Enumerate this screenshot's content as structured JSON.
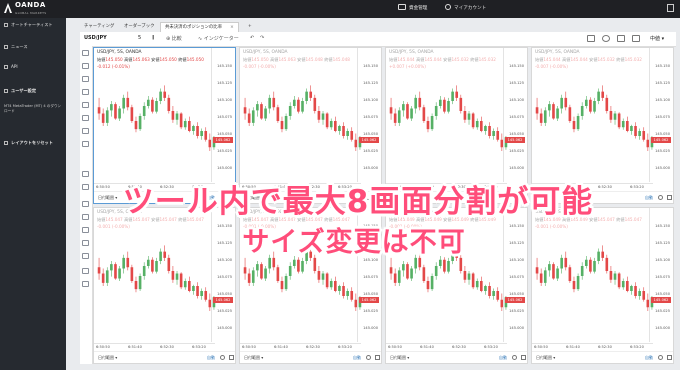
{
  "topbar": {
    "logo": "OANDA",
    "logo_sub": "GLOBAL MARKETS",
    "items": [
      "資金管理",
      "マイアカウント"
    ]
  },
  "sidebar": {
    "items": [
      {
        "label": "オートチャーティスト",
        "bold": false
      },
      {
        "label": "ニュース",
        "bold": false
      },
      {
        "label": "API",
        "bold": false
      },
      {
        "label": "ユーザー設定",
        "bold": true
      },
      {
        "label": "MT4 MetaTrader (MT) 4 のダウンロード",
        "bold": false,
        "sub": true
      },
      {
        "label": "レイアウトをリセット",
        "bold": true
      }
    ]
  },
  "tabs": [
    "チャーティング",
    "オーダーブック",
    "共未決済のポジションの比率"
  ],
  "toolbar": {
    "symbol": "USD/JPY",
    "interval": "5",
    "compare": "比較",
    "indicators": "インジケーター",
    "mode": "中値"
  },
  "colors": {
    "up": "#56b065",
    "down": "#e34848",
    "accent": "#ff4d7a"
  },
  "panes": [
    {
      "title": "USD/JPY, 5S, OANDA",
      "open": "145.050",
      "high": "145.063",
      "low": "145.050",
      "close": "145.050",
      "change": "-0.012 (-0.01%)",
      "faint": false,
      "selected": true
    },
    {
      "title": "USD/JPY, 5S, OANDA",
      "open": "145.050",
      "high": "145.063",
      "low": "145.048",
      "close": "145.048",
      "change": "-0.007 (-0.00%)",
      "faint": true,
      "selected": false
    },
    {
      "title": "USD/JPY, 5S, OANDA",
      "open": "145.044",
      "high": "145.044",
      "low": "145.032",
      "close": "145.032",
      "change": "+0.007 (+0.00%)",
      "faint": true,
      "selected": false
    },
    {
      "title": "USD/JPY, 5S, OANDA",
      "open": "145.044",
      "high": "145.044",
      "low": "145.032",
      "close": "145.032",
      "change": "-0.007 (-0.00%)",
      "faint": true,
      "selected": false
    },
    {
      "title": "USD/JPY, 5S, OANDA",
      "open": "145.047",
      "high": "145.047",
      "low": "145.047",
      "close": "145.047",
      "change": "-0.001 (-0.00%)",
      "faint": true,
      "selected": false
    },
    {
      "title": "USD/JPY, 5S, OANDA",
      "open": "145.047",
      "high": "145.047",
      "low": "145.047",
      "close": "145.047",
      "change": "-0.001 (-0.00%)",
      "faint": true,
      "selected": false
    },
    {
      "title": "USD/JPY, 5S, OANDA",
      "open": "145.049",
      "high": "145.049",
      "low": "145.049",
      "close": "145.049",
      "change": "-0.001 (-0.00%)",
      "faint": true,
      "selected": false
    },
    {
      "title": "USD/JPY, 5S, OANDA",
      "open": "145.049",
      "high": "145.049",
      "low": "145.047",
      "close": "145.047",
      "change": "-0.001 (-0.00%)",
      "faint": true,
      "selected": false
    }
  ],
  "pane_labels": {
    "open": "始値",
    "high": "高値",
    "low": "安値",
    "close": "終値",
    "range": "日付範囲",
    "auto": "自動"
  },
  "y_ticks": [
    "145.150",
    "145.125",
    "145.100",
    "145.075",
    "145.050",
    "145.025",
    "145.000"
  ],
  "last_price": "145.062",
  "x_ticks": [
    "6:50:50",
    "6:51:40",
    "6:52:30",
    "6:53:20"
  ],
  "candles": [
    [
      145.11,
      145.125,
      145.09,
      145.1
    ],
    [
      145.1,
      145.108,
      145.08,
      145.085
    ],
    [
      145.085,
      145.11,
      145.08,
      145.105
    ],
    [
      145.105,
      145.12,
      145.095,
      145.115
    ],
    [
      145.115,
      145.118,
      145.09,
      145.092
    ],
    [
      145.092,
      145.112,
      145.088,
      145.108
    ],
    [
      145.108,
      145.13,
      145.1,
      145.125
    ],
    [
      145.125,
      145.135,
      145.105,
      145.11
    ],
    [
      145.11,
      145.114,
      145.085,
      145.088
    ],
    [
      145.088,
      145.095,
      145.07,
      145.075
    ],
    [
      145.075,
      145.1,
      145.072,
      145.096
    ],
    [
      145.096,
      145.118,
      145.09,
      145.112
    ],
    [
      145.112,
      145.128,
      145.108,
      145.122
    ],
    [
      145.122,
      145.126,
      145.1,
      145.103
    ],
    [
      145.103,
      145.125,
      145.1,
      145.12
    ],
    [
      145.12,
      145.14,
      145.115,
      145.135
    ],
    [
      145.135,
      145.145,
      145.12,
      145.125
    ],
    [
      145.125,
      145.13,
      145.1,
      145.104
    ],
    [
      145.104,
      145.112,
      145.085,
      145.09
    ],
    [
      145.09,
      145.104,
      145.082,
      145.1
    ],
    [
      145.1,
      145.102,
      145.075,
      145.078
    ],
    [
      145.078,
      145.092,
      145.074,
      145.088
    ],
    [
      145.088,
      145.095,
      145.07,
      145.072
    ],
    [
      145.072,
      145.082,
      145.066,
      145.08
    ],
    [
      145.08,
      145.086,
      145.06,
      145.064
    ],
    [
      145.064,
      145.076,
      145.058,
      145.072
    ],
    [
      145.072,
      145.078,
      145.055,
      145.058
    ],
    [
      145.058,
      145.068,
      145.04,
      145.046
    ],
    [
      145.046,
      145.064,
      145.042,
      145.062
    ]
  ],
  "caption": {
    "line1": "ツール内で最大8画面分割が可能",
    "line2": "サイズ変更は不可"
  }
}
